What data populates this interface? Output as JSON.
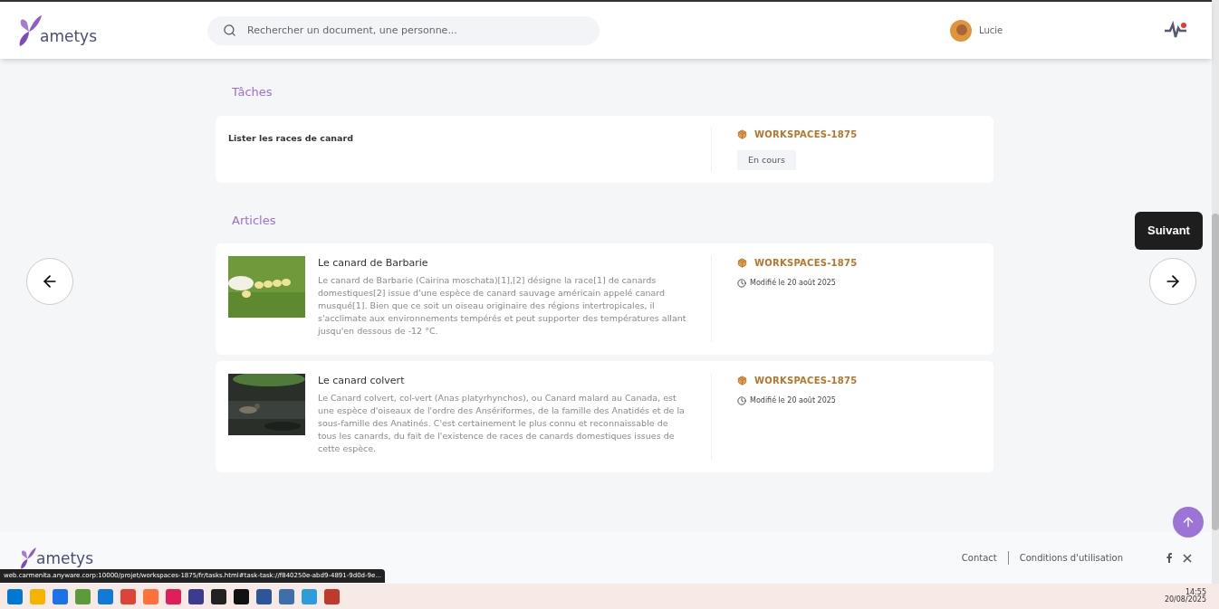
{
  "header": {
    "logo": "ametys",
    "search": {
      "placeholder": "Rechercher un document, une personne..."
    },
    "user": {
      "name": "Lucie"
    },
    "notification": true
  },
  "sections": [
    {
      "title": "Tâches",
      "kind": "tasks",
      "items": [
        {
          "title": "Lister les races de canard",
          "workspace": "WORKSPACES-1875",
          "status": "En cours"
        }
      ]
    },
    {
      "title": "Articles",
      "kind": "articles",
      "items": [
        {
          "title": "Le canard de Barbarie",
          "text": "Le canard de Barbarie (Cairina moschata)[1],[2] désigne la race[1] de canards domestiques[2] issue d'une espèce de canard sauvage américain appelé canard musqué[1]. Bien que ce soit un oiseau originaire des régions intertropicales, il s'acclimate aux environnements tempérés et peut supporter des températures allant jusqu'en dessous de -12 °C.",
          "workspace": "WORKSPACES-1875",
          "modified": "Modifié le 20 août 2025"
        },
        {
          "title": "Le canard colvert",
          "text": "Le Canard colvert, col-vert (Anas platyrhynchos), ou Canard malard au Canada, est une espèce d'oiseaux de l'ordre des Ansériformes, de la famille des Anatidés et de la sous-famille des Anatinés. C'est certainement le plus connu et reconnaissable de tous les canards, du fait de l'existence de races de canards domestiques issues de cette espèce.",
          "workspace": "WORKSPACES-1875",
          "modified": "Modifié le 20 août 2025"
        }
      ]
    }
  ],
  "tooltip": "Suivant",
  "footer": {
    "logo": "ametys",
    "links": [
      "Contact",
      "Conditions d'utilisation"
    ]
  },
  "status_url": "web.carmenita.anyware.corp:10000/projet/workspaces-1875/fr/tasks.html#task-task://f840250e-abd9-4891-9d0d-9e...",
  "taskbar": {
    "time": "14:55",
    "date": "20/08/2025",
    "apps": [
      {
        "color": "#0078d4"
      },
      {
        "color": "#f4b400"
      },
      {
        "color": "#1a73e8"
      },
      {
        "color": "#5b9b3a"
      },
      {
        "color": "#0f7bd6"
      },
      {
        "color": "#db4437"
      },
      {
        "color": "#ff7139"
      },
      {
        "color": "#e01e5a"
      },
      {
        "color": "#3b3b8f"
      },
      {
        "color": "#222222"
      },
      {
        "color": "#111111"
      },
      {
        "color": "#2b579a"
      },
      {
        "color": "#3d6fa8"
      },
      {
        "color": "#2d9cdb"
      },
      {
        "color": "#c0392b"
      }
    ]
  }
}
